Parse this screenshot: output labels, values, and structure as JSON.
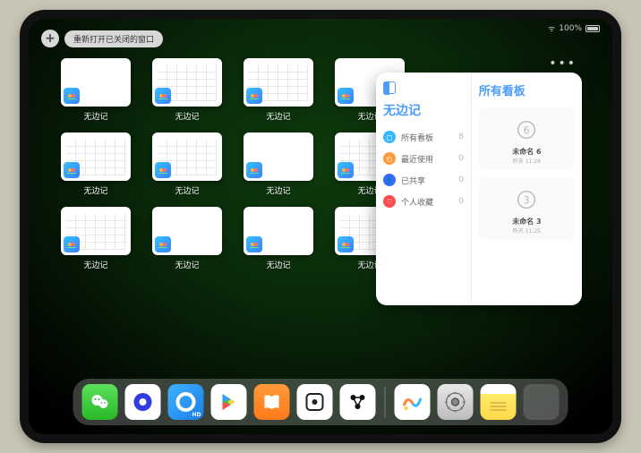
{
  "statusbar": {
    "wifi": "ᯤ",
    "battery": "100%"
  },
  "topbar": {
    "plus": "+",
    "reopen": "重新打开已关闭的窗口"
  },
  "tiles": [
    {
      "name": "无边记",
      "v": "blank"
    },
    {
      "name": "无边记",
      "v": "cal"
    },
    {
      "name": "无边记",
      "v": "cal"
    },
    {
      "name": "无边记",
      "v": "blank"
    },
    {
      "name": "无边记",
      "v": "cal"
    },
    {
      "name": "无边记",
      "v": "cal"
    },
    {
      "name": "无边记",
      "v": "blank"
    },
    {
      "name": "无边记",
      "v": "cal"
    },
    {
      "name": "无边记",
      "v": "cal"
    },
    {
      "name": "无边记",
      "v": "blank"
    },
    {
      "name": "无边记",
      "v": "blank"
    },
    {
      "name": "无边记",
      "v": "cal"
    }
  ],
  "card": {
    "title": "无边记",
    "rightTitle": "所有看板",
    "items": [
      {
        "icon": "b",
        "glyph": "◻",
        "label": "所有看板",
        "count": "8"
      },
      {
        "icon": "o",
        "glyph": "◴",
        "label": "最近使用",
        "count": "0"
      },
      {
        "icon": "bl",
        "glyph": "👤",
        "label": "已共享",
        "count": "0"
      },
      {
        "icon": "r",
        "glyph": "♡",
        "label": "个人收藏",
        "count": "0"
      }
    ],
    "boards": [
      {
        "name": "未命名 6",
        "sub": "昨天 11:26",
        "digit": "6"
      },
      {
        "name": "未命名 3",
        "sub": "昨天 11:25",
        "digit": "3"
      }
    ]
  },
  "dock": [
    {
      "name": "wechat"
    },
    {
      "name": "quark"
    },
    {
      "name": "qq"
    },
    {
      "name": "play"
    },
    {
      "name": "books"
    },
    {
      "name": "dice"
    },
    {
      "name": "irig"
    },
    {
      "name": "freeform"
    },
    {
      "name": "settings"
    },
    {
      "name": "notes"
    },
    {
      "name": "folder"
    }
  ]
}
